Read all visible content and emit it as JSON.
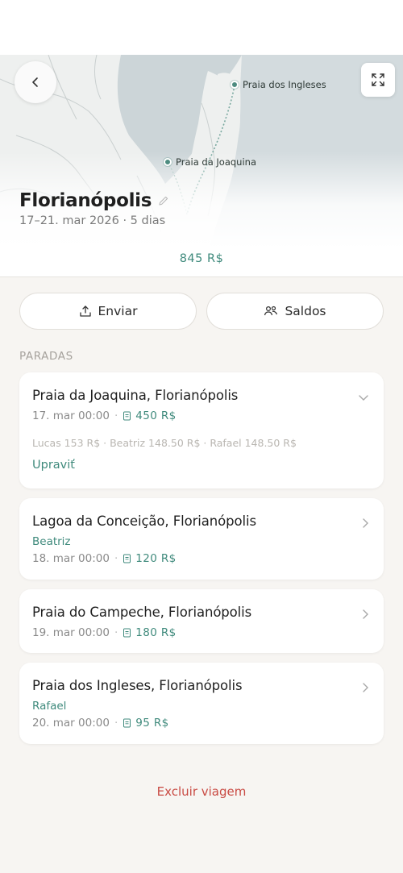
{
  "map": {
    "pins": [
      {
        "label": "Praia dos Ingleses"
      },
      {
        "label": "Praia da Joaquina"
      }
    ]
  },
  "trip": {
    "title": "Florianópolis",
    "dates": "17–21. mar 2026 · 5 dias",
    "total": "845  R$"
  },
  "actions": {
    "send_label": "Enviar",
    "balances_label": "Saldos"
  },
  "stops_section_label": "PARADAS",
  "stops": [
    {
      "name": "Praia da Joaquina, Florianópolis",
      "datetime": "17. mar 00:00",
      "amount": "450  R$",
      "split": "Lucas 153 R$ · Beatriz 148.50 R$ · Rafael 148.50 R$",
      "edit_label": "Upraviť",
      "expanded": true
    },
    {
      "name": "Lagoa da Conceição, Florianópolis",
      "payer": "Beatriz",
      "datetime": "18. mar 00:00",
      "amount": "120  R$"
    },
    {
      "name": "Praia do Campeche, Florianópolis",
      "datetime": "19. mar 00:00",
      "amount": "180  R$"
    },
    {
      "name": "Praia dos Ingleses, Florianópolis",
      "payer": "Rafael",
      "datetime": "20. mar 00:00",
      "amount": "95  R$"
    }
  ],
  "delete_label": "Excluir viagem",
  "colors": {
    "accent": "#3f8a7c",
    "danger": "#c94b44",
    "background": "#f7f5f2"
  }
}
